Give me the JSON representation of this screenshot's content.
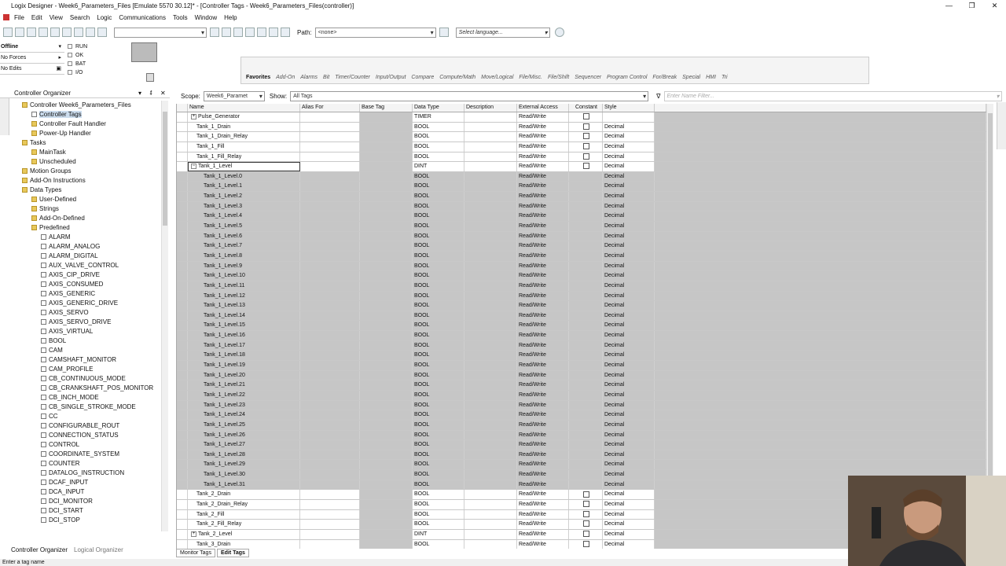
{
  "window": {
    "title": "Logix Designer - Week6_Parameters_Files [Emulate 5570 30.12]* - [Controller Tags - Week6_Parameters_Files(controller)]",
    "minimize": "—",
    "restore": "❐",
    "close": "✕"
  },
  "menu": [
    "File",
    "Edit",
    "View",
    "Search",
    "Logic",
    "Communications",
    "Tools",
    "Window",
    "Help"
  ],
  "toolbar": {
    "path_label": "Path:",
    "path_value": "<none>",
    "language_placeholder": "Select language..."
  },
  "status": {
    "mode": "Offline",
    "forces": "No Forces",
    "edits": "No Edits",
    "leds": [
      "RUN",
      "OK",
      "BAT",
      "I/O"
    ]
  },
  "instruction_tabs": [
    "Favorites",
    "Add-On",
    "Alarms",
    "Bit",
    "Timer/Counter",
    "Input/Output",
    "Compare",
    "Compute/Math",
    "Move/Logical",
    "File/Misc.",
    "File/Shift",
    "Sequencer",
    "Program Control",
    "For/Break",
    "Special",
    "HMI",
    "Tri"
  ],
  "organizer": {
    "title": "Controller Organizer",
    "tabs": [
      "Controller Organizer",
      "Logical Organizer"
    ],
    "tree": [
      {
        "label": "Controller Week6_Parameters_Files",
        "indent": 1,
        "icon": "y"
      },
      {
        "label": "Controller Tags",
        "indent": 2,
        "icon": "d",
        "selected": true
      },
      {
        "label": "Controller Fault Handler",
        "indent": 2,
        "icon": "y"
      },
      {
        "label": "Power-Up Handler",
        "indent": 2,
        "icon": "y"
      },
      {
        "label": "Tasks",
        "indent": 1,
        "icon": "y"
      },
      {
        "label": "MainTask",
        "indent": 2,
        "icon": "y"
      },
      {
        "label": "Unscheduled",
        "indent": 2,
        "icon": "y"
      },
      {
        "label": "Motion Groups",
        "indent": 1,
        "icon": "y"
      },
      {
        "label": "Add-On Instructions",
        "indent": 1,
        "icon": "y"
      },
      {
        "label": "Data Types",
        "indent": 1,
        "icon": "y"
      },
      {
        "label": "User-Defined",
        "indent": 2,
        "icon": "y"
      },
      {
        "label": "Strings",
        "indent": 2,
        "icon": "y"
      },
      {
        "label": "Add-On-Defined",
        "indent": 2,
        "icon": "y"
      },
      {
        "label": "Predefined",
        "indent": 2,
        "icon": "y"
      },
      {
        "label": "ALARM",
        "indent": 3,
        "icon": "d"
      },
      {
        "label": "ALARM_ANALOG",
        "indent": 3,
        "icon": "d"
      },
      {
        "label": "ALARM_DIGITAL",
        "indent": 3,
        "icon": "d"
      },
      {
        "label": "AUX_VALVE_CONTROL",
        "indent": 3,
        "icon": "d"
      },
      {
        "label": "AXIS_CIP_DRIVE",
        "indent": 3,
        "icon": "d"
      },
      {
        "label": "AXIS_CONSUMED",
        "indent": 3,
        "icon": "d"
      },
      {
        "label": "AXIS_GENERIC",
        "indent": 3,
        "icon": "d"
      },
      {
        "label": "AXIS_GENERIC_DRIVE",
        "indent": 3,
        "icon": "d"
      },
      {
        "label": "AXIS_SERVO",
        "indent": 3,
        "icon": "d"
      },
      {
        "label": "AXIS_SERVO_DRIVE",
        "indent": 3,
        "icon": "d"
      },
      {
        "label": "AXIS_VIRTUAL",
        "indent": 3,
        "icon": "d"
      },
      {
        "label": "BOOL",
        "indent": 3,
        "icon": "d"
      },
      {
        "label": "CAM",
        "indent": 3,
        "icon": "d"
      },
      {
        "label": "CAMSHAFT_MONITOR",
        "indent": 3,
        "icon": "d"
      },
      {
        "label": "CAM_PROFILE",
        "indent": 3,
        "icon": "d"
      },
      {
        "label": "CB_CONTINUOUS_MODE",
        "indent": 3,
        "icon": "d"
      },
      {
        "label": "CB_CRANKSHAFT_POS_MONITOR",
        "indent": 3,
        "icon": "d"
      },
      {
        "label": "CB_INCH_MODE",
        "indent": 3,
        "icon": "d"
      },
      {
        "label": "CB_SINGLE_STROKE_MODE",
        "indent": 3,
        "icon": "d"
      },
      {
        "label": "CC",
        "indent": 3,
        "icon": "d"
      },
      {
        "label": "CONFIGURABLE_ROUT",
        "indent": 3,
        "icon": "d"
      },
      {
        "label": "CONNECTION_STATUS",
        "indent": 3,
        "icon": "d"
      },
      {
        "label": "CONTROL",
        "indent": 3,
        "icon": "d"
      },
      {
        "label": "COORDINATE_SYSTEM",
        "indent": 3,
        "icon": "d"
      },
      {
        "label": "COUNTER",
        "indent": 3,
        "icon": "d"
      },
      {
        "label": "DATALOG_INSTRUCTION",
        "indent": 3,
        "icon": "d"
      },
      {
        "label": "DCAF_INPUT",
        "indent": 3,
        "icon": "d"
      },
      {
        "label": "DCA_INPUT",
        "indent": 3,
        "icon": "d"
      },
      {
        "label": "DCI_MONITOR",
        "indent": 3,
        "icon": "d"
      },
      {
        "label": "DCI_START",
        "indent": 3,
        "icon": "d"
      },
      {
        "label": "DCI_STOP",
        "indent": 3,
        "icon": "d"
      }
    ]
  },
  "scope": {
    "label": "Scope:",
    "value": "Week6_Paramet",
    "show_label": "Show:",
    "show_value": "All Tags",
    "filter_placeholder": "Enter Name Filter..."
  },
  "columns": [
    "Name",
    "Alias For",
    "Base Tag",
    "Data Type",
    "Description",
    "External Access",
    "Constant",
    "Style"
  ],
  "rows": [
    {
      "name": "Pulse_Generator",
      "type": "TIMER",
      "ext": "Read/Write",
      "const": true,
      "style": "",
      "pm": "+"
    },
    {
      "name": "Tank_1_Drain",
      "type": "BOOL",
      "ext": "Read/Write",
      "const": true,
      "style": "Decimal"
    },
    {
      "name": "Tank_1_Drain_Relay",
      "type": "BOOL",
      "ext": "Read/Write",
      "const": true,
      "style": "Decimal"
    },
    {
      "name": "Tank_1_Fill",
      "type": "BOOL",
      "ext": "Read/Write",
      "const": true,
      "style": "Decimal"
    },
    {
      "name": "Tank_1_Fill_Relay",
      "type": "BOOL",
      "ext": "Read/Write",
      "const": true,
      "style": "Decimal"
    },
    {
      "name": "Tank_1_Level",
      "type": "DINT",
      "ext": "Read/Write",
      "const": true,
      "style": "Decimal",
      "pm": "−",
      "selected": true
    },
    {
      "name": "Tank_1_Level.0",
      "type": "BOOL",
      "ext": "Read/Write",
      "style": "Decimal",
      "sub": true
    },
    {
      "name": "Tank_1_Level.1",
      "type": "BOOL",
      "ext": "Read/Write",
      "style": "Decimal",
      "sub": true
    },
    {
      "name": "Tank_1_Level.2",
      "type": "BOOL",
      "ext": "Read/Write",
      "style": "Decimal",
      "sub": true
    },
    {
      "name": "Tank_1_Level.3",
      "type": "BOOL",
      "ext": "Read/Write",
      "style": "Decimal",
      "sub": true
    },
    {
      "name": "Tank_1_Level.4",
      "type": "BOOL",
      "ext": "Read/Write",
      "style": "Decimal",
      "sub": true
    },
    {
      "name": "Tank_1_Level.5",
      "type": "BOOL",
      "ext": "Read/Write",
      "style": "Decimal",
      "sub": true
    },
    {
      "name": "Tank_1_Level.6",
      "type": "BOOL",
      "ext": "Read/Write",
      "style": "Decimal",
      "sub": true
    },
    {
      "name": "Tank_1_Level.7",
      "type": "BOOL",
      "ext": "Read/Write",
      "style": "Decimal",
      "sub": true
    },
    {
      "name": "Tank_1_Level.8",
      "type": "BOOL",
      "ext": "Read/Write",
      "style": "Decimal",
      "sub": true
    },
    {
      "name": "Tank_1_Level.9",
      "type": "BOOL",
      "ext": "Read/Write",
      "style": "Decimal",
      "sub": true
    },
    {
      "name": "Tank_1_Level.10",
      "type": "BOOL",
      "ext": "Read/Write",
      "style": "Decimal",
      "sub": true
    },
    {
      "name": "Tank_1_Level.11",
      "type": "BOOL",
      "ext": "Read/Write",
      "style": "Decimal",
      "sub": true
    },
    {
      "name": "Tank_1_Level.12",
      "type": "BOOL",
      "ext": "Read/Write",
      "style": "Decimal",
      "sub": true
    },
    {
      "name": "Tank_1_Level.13",
      "type": "BOOL",
      "ext": "Read/Write",
      "style": "Decimal",
      "sub": true
    },
    {
      "name": "Tank_1_Level.14",
      "type": "BOOL",
      "ext": "Read/Write",
      "style": "Decimal",
      "sub": true
    },
    {
      "name": "Tank_1_Level.15",
      "type": "BOOL",
      "ext": "Read/Write",
      "style": "Decimal",
      "sub": true
    },
    {
      "name": "Tank_1_Level.16",
      "type": "BOOL",
      "ext": "Read/Write",
      "style": "Decimal",
      "sub": true
    },
    {
      "name": "Tank_1_Level.17",
      "type": "BOOL",
      "ext": "Read/Write",
      "style": "Decimal",
      "sub": true
    },
    {
      "name": "Tank_1_Level.18",
      "type": "BOOL",
      "ext": "Read/Write",
      "style": "Decimal",
      "sub": true
    },
    {
      "name": "Tank_1_Level.19",
      "type": "BOOL",
      "ext": "Read/Write",
      "style": "Decimal",
      "sub": true
    },
    {
      "name": "Tank_1_Level.20",
      "type": "BOOL",
      "ext": "Read/Write",
      "style": "Decimal",
      "sub": true
    },
    {
      "name": "Tank_1_Level.21",
      "type": "BOOL",
      "ext": "Read/Write",
      "style": "Decimal",
      "sub": true
    },
    {
      "name": "Tank_1_Level.22",
      "type": "BOOL",
      "ext": "Read/Write",
      "style": "Decimal",
      "sub": true
    },
    {
      "name": "Tank_1_Level.23",
      "type": "BOOL",
      "ext": "Read/Write",
      "style": "Decimal",
      "sub": true
    },
    {
      "name": "Tank_1_Level.24",
      "type": "BOOL",
      "ext": "Read/Write",
      "style": "Decimal",
      "sub": true
    },
    {
      "name": "Tank_1_Level.25",
      "type": "BOOL",
      "ext": "Read/Write",
      "style": "Decimal",
      "sub": true
    },
    {
      "name": "Tank_1_Level.26",
      "type": "BOOL",
      "ext": "Read/Write",
      "style": "Decimal",
      "sub": true
    },
    {
      "name": "Tank_1_Level.27",
      "type": "BOOL",
      "ext": "Read/Write",
      "style": "Decimal",
      "sub": true
    },
    {
      "name": "Tank_1_Level.28",
      "type": "BOOL",
      "ext": "Read/Write",
      "style": "Decimal",
      "sub": true
    },
    {
      "name": "Tank_1_Level.29",
      "type": "BOOL",
      "ext": "Read/Write",
      "style": "Decimal",
      "sub": true
    },
    {
      "name": "Tank_1_Level.30",
      "type": "BOOL",
      "ext": "Read/Write",
      "style": "Decimal",
      "sub": true
    },
    {
      "name": "Tank_1_Level.31",
      "type": "BOOL",
      "ext": "Read/Write",
      "style": "Decimal",
      "sub": true
    },
    {
      "name": "Tank_2_Drain",
      "type": "BOOL",
      "ext": "Read/Write",
      "const": true,
      "style": "Decimal"
    },
    {
      "name": "Tank_2_Drain_Relay",
      "type": "BOOL",
      "ext": "Read/Write",
      "const": true,
      "style": "Decimal"
    },
    {
      "name": "Tank_2_Fill",
      "type": "BOOL",
      "ext": "Read/Write",
      "const": true,
      "style": "Decimal"
    },
    {
      "name": "Tank_2_Fill_Relay",
      "type": "BOOL",
      "ext": "Read/Write",
      "const": true,
      "style": "Decimal"
    },
    {
      "name": "Tank_2_Level",
      "type": "DINT",
      "ext": "Read/Write",
      "const": true,
      "style": "Decimal",
      "pm": "+"
    },
    {
      "name": "Tank_3_Drain",
      "type": "BOOL",
      "ext": "Read/Write",
      "const": true,
      "style": "Decimal"
    }
  ],
  "bottom_tabs": [
    "Monitor Tags",
    "Edit Tags"
  ],
  "statusline": "Enter a tag name"
}
